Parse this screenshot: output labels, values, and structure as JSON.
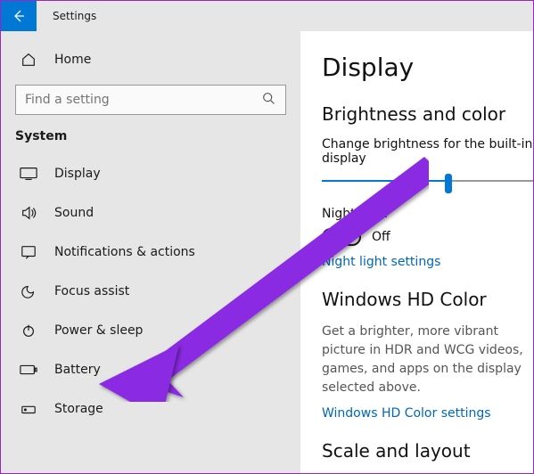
{
  "titlebar": {
    "title": "Settings"
  },
  "home_label": "Home",
  "search": {
    "placeholder": "Find a setting"
  },
  "group_label": "System",
  "nav": {
    "display": "Display",
    "sound": "Sound",
    "notifications": "Notifications & actions",
    "focus": "Focus assist",
    "power": "Power & sleep",
    "battery": "Battery",
    "storage": "Storage"
  },
  "main": {
    "page_title": "Display",
    "brightness_heading": "Brightness and color",
    "brightness_label": "Change brightness for the built-in display",
    "night_light_label": "Night light",
    "toggle_off": "Off",
    "night_light_link": "Night light settings",
    "hd_heading": "Windows HD Color",
    "hd_desc": "Get a brighter, more vibrant picture in HDR and WCG videos, games, and apps on the display selected above.",
    "hd_link": "Windows HD Color settings",
    "scale_heading": "Scale and layout"
  }
}
